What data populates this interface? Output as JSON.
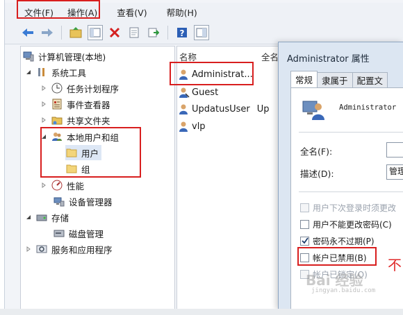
{
  "menubar": {
    "items": [
      "文件(F)",
      "操作(A)",
      "查看(V)",
      "帮助(H)"
    ]
  },
  "toolbar": {
    "icons": [
      "back-icon",
      "forward-icon",
      "up-folder-icon",
      "show-tree-icon",
      "delete-icon",
      "properties-icon",
      "export-icon",
      "help-icon",
      "view-icon"
    ]
  },
  "tree": {
    "root": "计算机管理(本地)",
    "system_tools": "系统工具",
    "task_scheduler": "任务计划程序",
    "event_viewer": "事件查看器",
    "shared_folders": "共享文件夹",
    "local_users_groups": "本地用户和组",
    "users": "用户",
    "groups": "组",
    "performance": "性能",
    "device_manager": "设备管理器",
    "storage": "存储",
    "disk_management": "磁盘管理",
    "services_apps": "服务和应用程序"
  },
  "list": {
    "col_name": "名称",
    "col_fullname": "全名",
    "rows": [
      {
        "name": "Administrat...",
        "fullname": ""
      },
      {
        "name": "Guest",
        "fullname": ""
      },
      {
        "name": "UpdatusUser",
        "fullname": "Up"
      },
      {
        "name": "vlp",
        "fullname": ""
      }
    ]
  },
  "dialog": {
    "title": "Administrator 属性",
    "tabs": [
      "常规",
      "隶属于",
      "配置文"
    ],
    "user_name": "Administrator",
    "fullname_label": "全名(F):",
    "fullname_value": "",
    "description_label": "描述(D):",
    "description_value": "管理",
    "options": [
      {
        "label": "用户下次登录时须更改",
        "checked": false,
        "disabled": true
      },
      {
        "label": "用户不能更改密码(C)",
        "checked": false,
        "disabled": false
      },
      {
        "label": "密码永不过期(P)",
        "checked": true,
        "disabled": false
      },
      {
        "label": "帐户已禁用(B)",
        "checked": false,
        "disabled": false
      },
      {
        "label": "帐户已锁定(O)",
        "checked": false,
        "disabled": true
      }
    ]
  },
  "annotation": {
    "note": "不"
  },
  "watermark": {
    "text": "Bai 经验",
    "url": "jingyan.baidu.com"
  },
  "colors": {
    "highlight": "#d81e1e",
    "dialog_title_bg": "#dce6f2",
    "note_text": "#e02a2a"
  }
}
